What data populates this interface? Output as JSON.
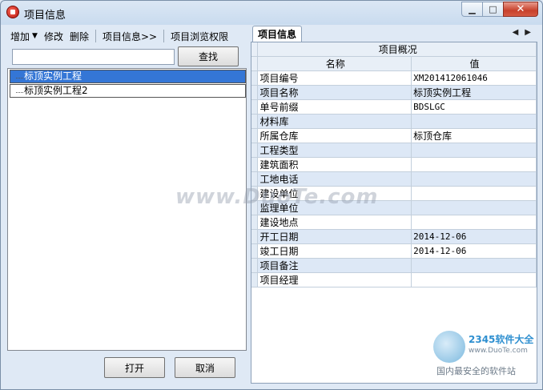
{
  "window": {
    "title": "项目信息",
    "minimize_glyph": "▁",
    "maximize_glyph": "□",
    "close_glyph": "✕"
  },
  "toolbar": {
    "add_label": "增加",
    "add_caret": "▼",
    "edit_label": "修改",
    "delete_label": "删除",
    "project_info_label": "项目信息>>",
    "browse_permission_label": "项目浏览权限"
  },
  "search": {
    "value": "",
    "placeholder": "",
    "button_label": "查找"
  },
  "tree": {
    "items": [
      {
        "label": "标顶实例工程",
        "selected": true
      },
      {
        "label": "标顶实例工程2",
        "selected": false
      }
    ]
  },
  "bottom_buttons": {
    "open_label": "打开",
    "cancel_label": "取消"
  },
  "right_panel": {
    "tab_label": "项目信息",
    "nav_prev": "◀",
    "nav_next": "▶",
    "section_title": "项目概况",
    "col_name": "名称",
    "col_value": "值",
    "rows": [
      {
        "name": "项目编号",
        "value": "XM201412061046"
      },
      {
        "name": "项目名称",
        "value": "标顶实例工程"
      },
      {
        "name": "单号前缀",
        "value": "BDSLGC"
      },
      {
        "name": "材料库",
        "value": ""
      },
      {
        "name": "所属仓库",
        "value": "标顶仓库"
      },
      {
        "name": "工程类型",
        "value": ""
      },
      {
        "name": "建筑面积",
        "value": ""
      },
      {
        "name": "工地电话",
        "value": ""
      },
      {
        "name": "建设单位",
        "value": ""
      },
      {
        "name": "监理单位",
        "value": ""
      },
      {
        "name": "建设地点",
        "value": ""
      },
      {
        "name": "开工日期",
        "value": "2014-12-06"
      },
      {
        "name": "竣工日期",
        "value": "2014-12-06"
      },
      {
        "name": "项目备注",
        "value": ""
      },
      {
        "name": "项目经理",
        "value": ""
      }
    ]
  },
  "watermark": {
    "site_text": "www.DuoTe.com",
    "brand_text": "2345软件大全",
    "brand_url": "www.DuoTe.com",
    "slogan": "国内最安全的软件站"
  }
}
